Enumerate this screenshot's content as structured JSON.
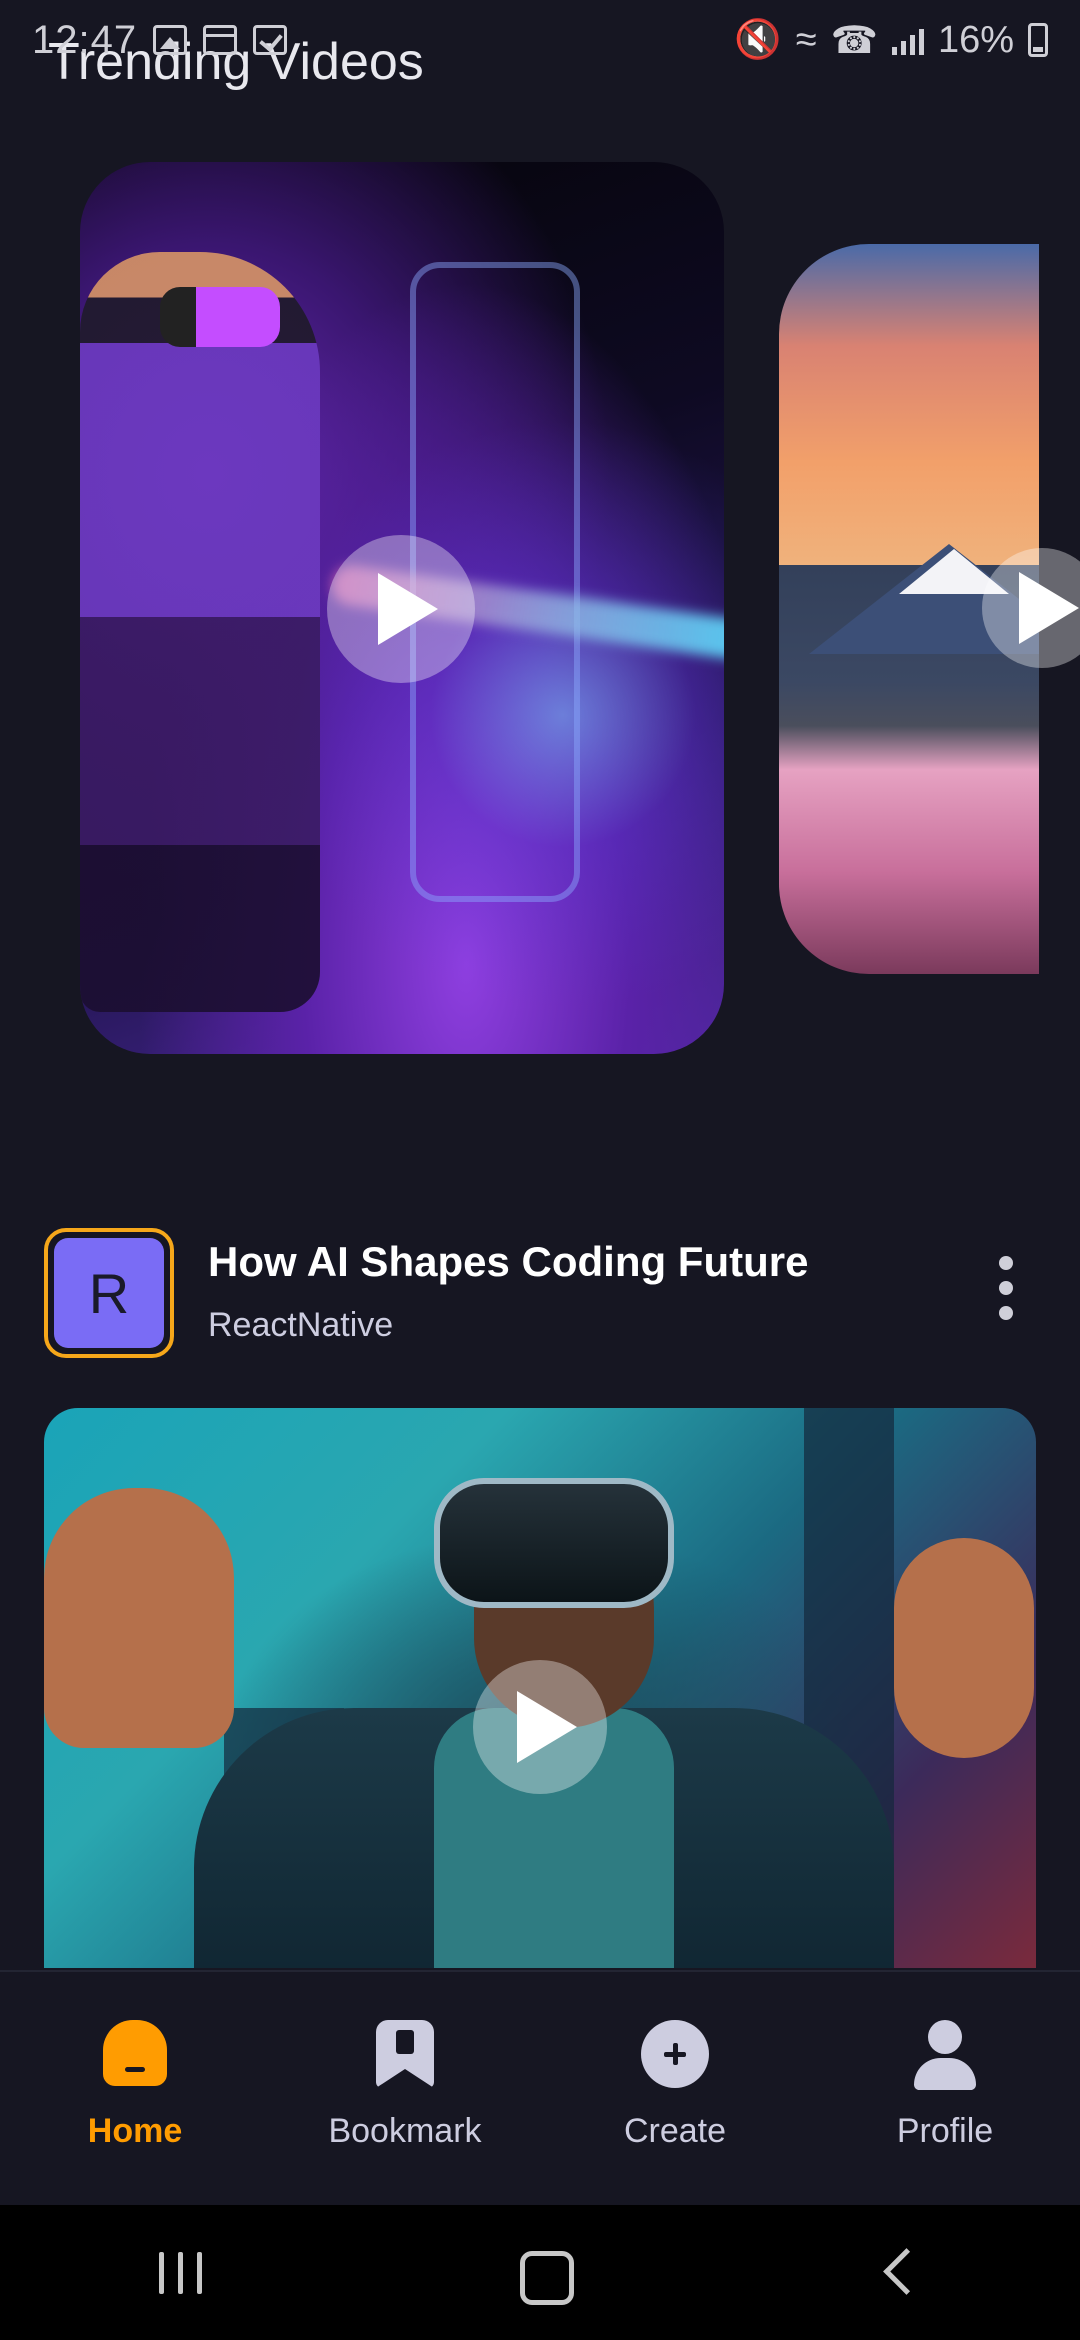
{
  "status_bar": {
    "time": "12:47",
    "battery": "16%"
  },
  "section": {
    "title": "Trending Videos"
  },
  "post": {
    "avatar_initial": "R",
    "title": "How AI Shapes Coding Future",
    "author": "ReactNative"
  },
  "nav": {
    "items": [
      {
        "label": "Home",
        "icon": "home-icon",
        "active": true
      },
      {
        "label": "Bookmark",
        "icon": "bookmark-icon",
        "active": false
      },
      {
        "label": "Create",
        "icon": "plus-circle-icon",
        "active": false
      },
      {
        "label": "Profile",
        "icon": "user-icon",
        "active": false
      }
    ]
  },
  "colors": {
    "background": "#161622",
    "accent": "#ff9c01",
    "avatar_fill": "#7a6cf5",
    "inactive": "#cdcde0"
  }
}
